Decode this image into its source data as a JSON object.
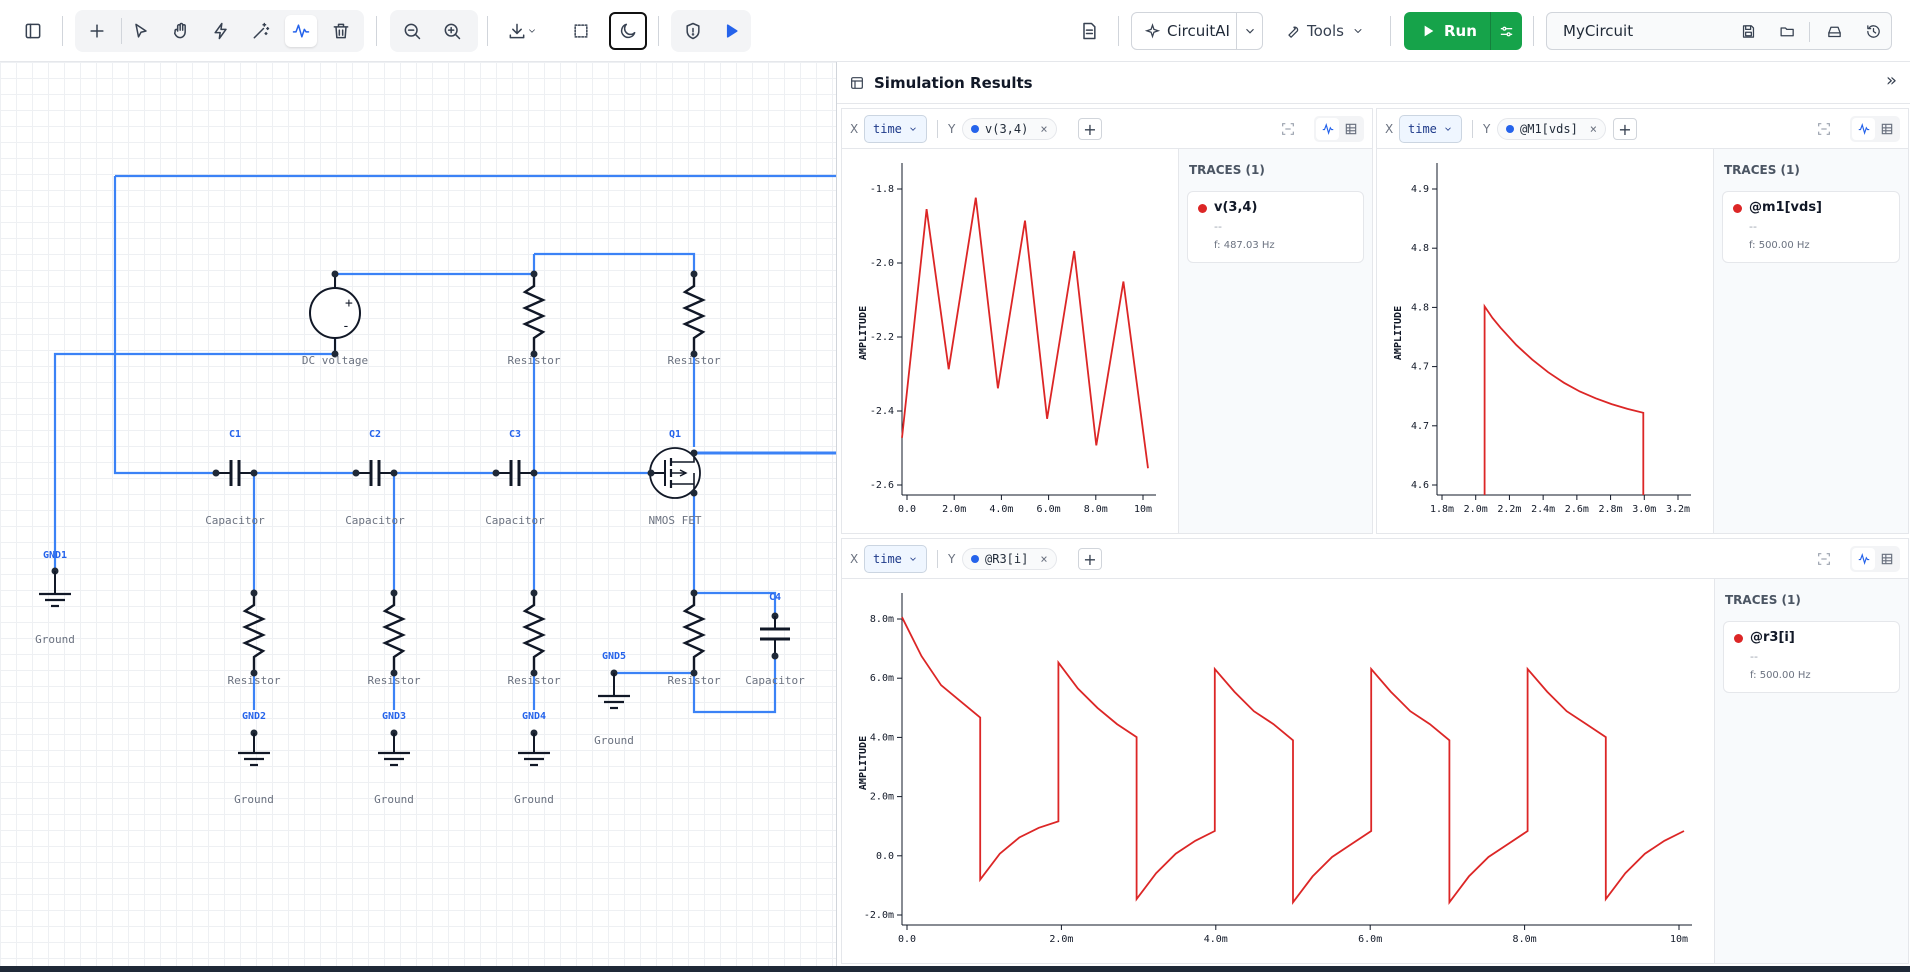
{
  "toolbar": {
    "icons": [
      "sidebar-toggle-icon",
      "plus-icon",
      "pointer-icon",
      "hand-icon",
      "lightning-icon",
      "magic-wand-icon",
      "waveform-icon",
      "trash-icon",
      "zoom-out-icon",
      "zoom-in-icon",
      "download-icon",
      "selection-icon",
      "moon-icon",
      "shield-icon",
      "play-icon",
      "document-icon"
    ],
    "circuitai_label": "CircuitAI",
    "tools_label": "Tools",
    "run_label": "Run",
    "circuit_name": "MyCircuit"
  },
  "colors": {
    "wire": "#3b82f6",
    "component": "#111827",
    "trace": "#dc2626",
    "run": "#16a34a",
    "accent": "#2563eb"
  },
  "circuit": {
    "labels": {
      "dc_voltage": "DC voltage",
      "r_top1": "Resistor",
      "r_top2": "Resistor",
      "c1_ref": "C1",
      "c2_ref": "C2",
      "c3_ref": "C3",
      "q1_ref": "Q1",
      "c1_type": "Capacitor",
      "c2_type": "Capacitor",
      "c3_type": "Capacitor",
      "q1_type": "NMOS FET",
      "gnd1_ref": "GND1",
      "gnd1_type": "Ground",
      "r_b1": "Resistor",
      "r_b2": "Resistor",
      "r_b3": "Resistor",
      "r_b4": "Resistor",
      "c4_ref": "C4",
      "c4_type": "Capacitor",
      "gnd5_ref": "GND5",
      "gnd5_type": "Ground",
      "gnd2_ref": "GND2",
      "gnd3_ref": "GND3",
      "gnd4_ref": "GND4",
      "gnd2_type": "Ground",
      "gnd3_type": "Ground",
      "gnd4_type": "Ground"
    }
  },
  "results": {
    "title": "Simulation Results",
    "panels": [
      {
        "x_label": "X",
        "x_value": "time",
        "y_label": "Y",
        "y_trace": "v(3,4)",
        "traces_header": "TRACES (1)",
        "trace_name": "v(3,4)",
        "trace_dash": "--",
        "trace_freq": "f: 487.03 Hz"
      },
      {
        "x_label": "X",
        "x_value": "time",
        "y_label": "Y",
        "y_trace": "@M1[vds]",
        "traces_header": "TRACES (1)",
        "trace_name": "@m1[vds]",
        "trace_dash": "--",
        "trace_freq": "f: 500.00 Hz"
      },
      {
        "x_label": "X",
        "x_value": "time",
        "y_label": "Y",
        "y_trace": "@R3[i]",
        "traces_header": "TRACES (1)",
        "trace_name": "@r3[i]",
        "trace_dash": "--",
        "trace_freq": "f: 500.00 Hz"
      }
    ]
  },
  "chart_data": [
    {
      "type": "line",
      "ylabel": "AMPLITUDE",
      "xticks": [
        "0.0",
        "2.0m",
        "4.0m",
        "6.0m",
        "8.0m",
        "10m"
      ],
      "yticks": [
        "-1.8",
        "-2.0",
        "-2.2",
        "-2.4",
        "-2.6"
      ],
      "xlim": [
        0,
        0.01
      ],
      "ylim": [
        -2.6,
        -1.75
      ],
      "series": [
        {
          "name": "v(3,4)",
          "x": [
            0,
            0.001,
            0.0019,
            0.003,
            0.0039,
            0.005,
            0.0059,
            0.007,
            0.0079,
            0.009,
            0.01
          ],
          "y": [
            -2.45,
            -1.85,
            -2.27,
            -1.82,
            -2.32,
            -1.88,
            -2.4,
            -1.96,
            -2.47,
            -2.04,
            -2.53
          ]
        }
      ]
    },
    {
      "type": "line",
      "ylabel": "AMPLITUDE",
      "xticks": [
        "1.8m",
        "2.0m",
        "2.2m",
        "2.4m",
        "2.6m",
        "2.8m",
        "3.0m",
        "3.2m"
      ],
      "yticks": [
        "4.9",
        "4.8",
        "4.8",
        "4.7",
        "4.7",
        "4.6"
      ],
      "xlim": [
        0.0017,
        0.00325
      ],
      "ylim": [
        4.595,
        4.93
      ],
      "series": [
        {
          "name": "@m1[vds]",
          "x": [
            0.002,
            0.002,
            0.00205,
            0.0021,
            0.0022,
            0.0023,
            0.0024,
            0.0025,
            0.0026,
            0.0027,
            0.0028,
            0.0029,
            0.003,
            0.003
          ],
          "y": [
            4.595,
            4.79,
            4.778,
            4.768,
            4.75,
            4.735,
            4.722,
            4.711,
            4.702,
            4.695,
            4.689,
            4.684,
            4.68,
            4.595
          ]
        }
      ]
    },
    {
      "type": "line",
      "ylabel": "AMPLITUDE",
      "xticks": [
        "0.0",
        "2.0m",
        "4.0m",
        "6.0m",
        "8.0m",
        "10m"
      ],
      "yticks": [
        "8.0m",
        "6.0m",
        "4.0m",
        "2.0m",
        "0.0",
        "-2.0m"
      ],
      "xlim": [
        0,
        0.01
      ],
      "ylim": [
        -0.002,
        0.008
      ],
      "series": [
        {
          "name": "@r3[i]",
          "x": [
            0,
            0.00025,
            0.0005,
            0.00075,
            0.001,
            0.001,
            0.00125,
            0.0015,
            0.00175,
            0.002,
            0.002,
            0.00225,
            0.0025,
            0.00275,
            0.003,
            0.003,
            0.00325,
            0.0035,
            0.00375,
            0.004,
            0.004,
            0.00425,
            0.0045,
            0.00475,
            0.005,
            0.005,
            0.00525,
            0.0055,
            0.00575,
            0.006,
            0.006,
            0.00625,
            0.0065,
            0.00675,
            0.007,
            0.007,
            0.00725,
            0.0075,
            0.00775,
            0.008,
            0.008,
            0.00825,
            0.0085,
            0.00875,
            0.009,
            0.009,
            0.00925,
            0.0095,
            0.00975,
            0.01
          ],
          "y": [
            0.0075,
            0.0063,
            0.0054,
            0.0049,
            0.0044,
            -0.0006,
            0.0002,
            0.0007,
            0.001,
            0.0012,
            0.0061,
            0.0053,
            0.0047,
            0.0042,
            0.0038,
            -0.0012,
            -0.0004,
            0.0002,
            0.0006,
            0.0009,
            0.0059,
            0.0052,
            0.0046,
            0.0042,
            0.0037,
            -0.0013,
            -0.0005,
            0.0001,
            0.0005,
            0.0009,
            0.0059,
            0.0052,
            0.0046,
            0.0042,
            0.0037,
            -0.0013,
            -0.0005,
            0.0001,
            0.0005,
            0.0009,
            0.0059,
            0.0052,
            0.0046,
            0.0042,
            0.0038,
            -0.0012,
            -0.0004,
            0.0002,
            0.0006,
            0.0009
          ]
        }
      ]
    }
  ]
}
